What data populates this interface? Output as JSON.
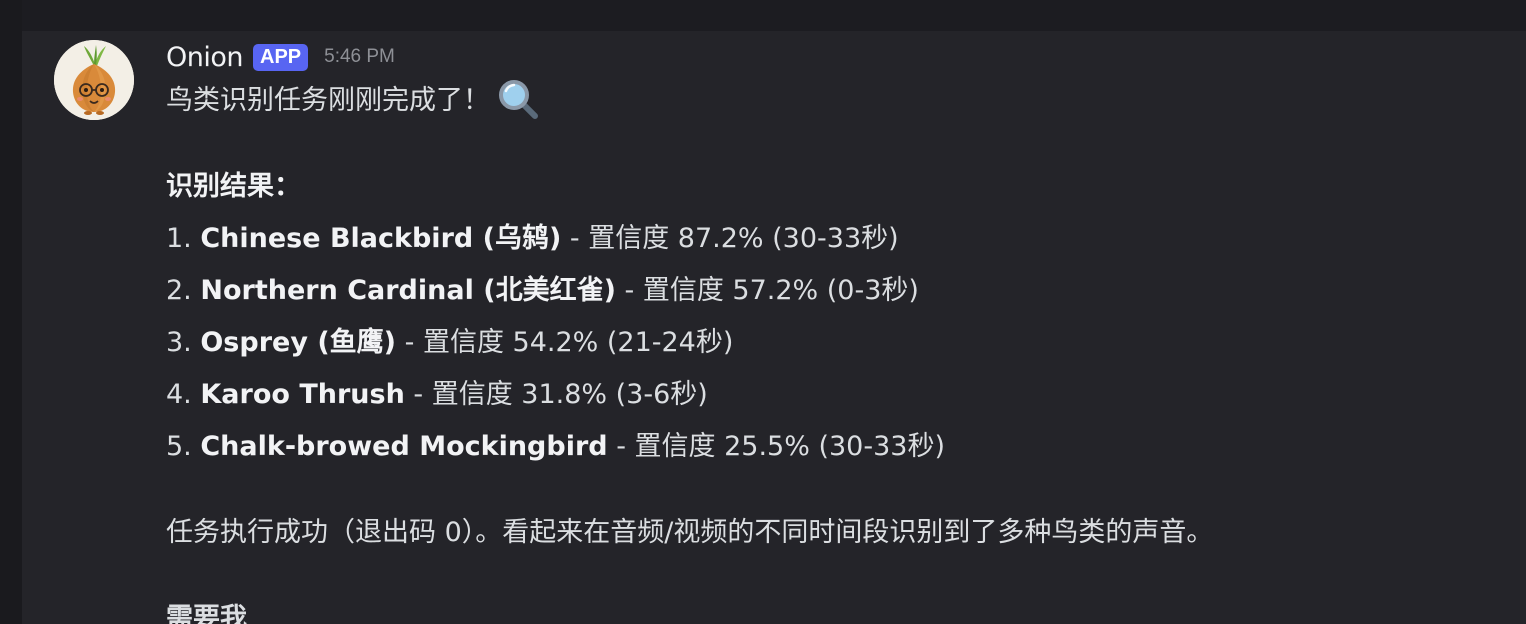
{
  "message": {
    "username": "Onion",
    "badge": "APP",
    "time": "5:46 PM",
    "intro": "鸟类识别任务刚刚完成了！",
    "intro_icon": "magnifier-icon",
    "results_heading": "识别结果：",
    "results": [
      {
        "index": "1.",
        "name": "Chinese Blackbird (乌鸫)",
        "rest": " - 置信度 87.2% (30-33秒)"
      },
      {
        "index": "2.",
        "name": "Northern Cardinal (北美红雀)",
        "rest": " - 置信度 57.2% (0-3秒)"
      },
      {
        "index": "3.",
        "name": "Osprey (鱼鹰)",
        "rest": " - 置信度 54.2% (21-24秒)"
      },
      {
        "index": "4.",
        "name": "Karoo Thrush",
        "rest": " - 置信度 31.8% (3-6秒)"
      },
      {
        "index": "5.",
        "name": "Chalk-browed Mockingbird",
        "rest": " - 置信度 25.5% (30-33秒)"
      }
    ],
    "summary": "任务执行成功（退出码 0）。看起来在音频/视频的不同时间段识别到了多种鸟类的声音。",
    "trailing_partial": "需要我"
  },
  "colors": {
    "background": "#242429",
    "badge": "#5865f2",
    "text": "#dbdee1"
  }
}
